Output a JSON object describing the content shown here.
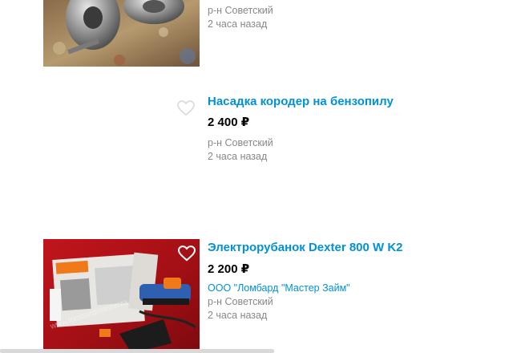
{
  "listings": [
    {
      "title": "",
      "price": "",
      "seller": "",
      "location": "р-н Советский",
      "posted": "2 часа назад"
    },
    {
      "title": "Насадка кородер на бензопилу",
      "price": "2 400 ₽",
      "seller": "",
      "location": "р-н Советский",
      "posted": "2 часа назад"
    },
    {
      "title": "Электрорубанок Dexter 800 W K2",
      "price": "2 200 ₽",
      "seller": "ООО \"Ломбард \"Мастер Займ\"",
      "location": "р-н Советский",
      "posted": "2 часа назад"
    }
  ],
  "icons": {
    "favorite": "heart-icon"
  },
  "colors": {
    "link": "#0091d9",
    "meta": "#888888",
    "price": "#000000"
  }
}
